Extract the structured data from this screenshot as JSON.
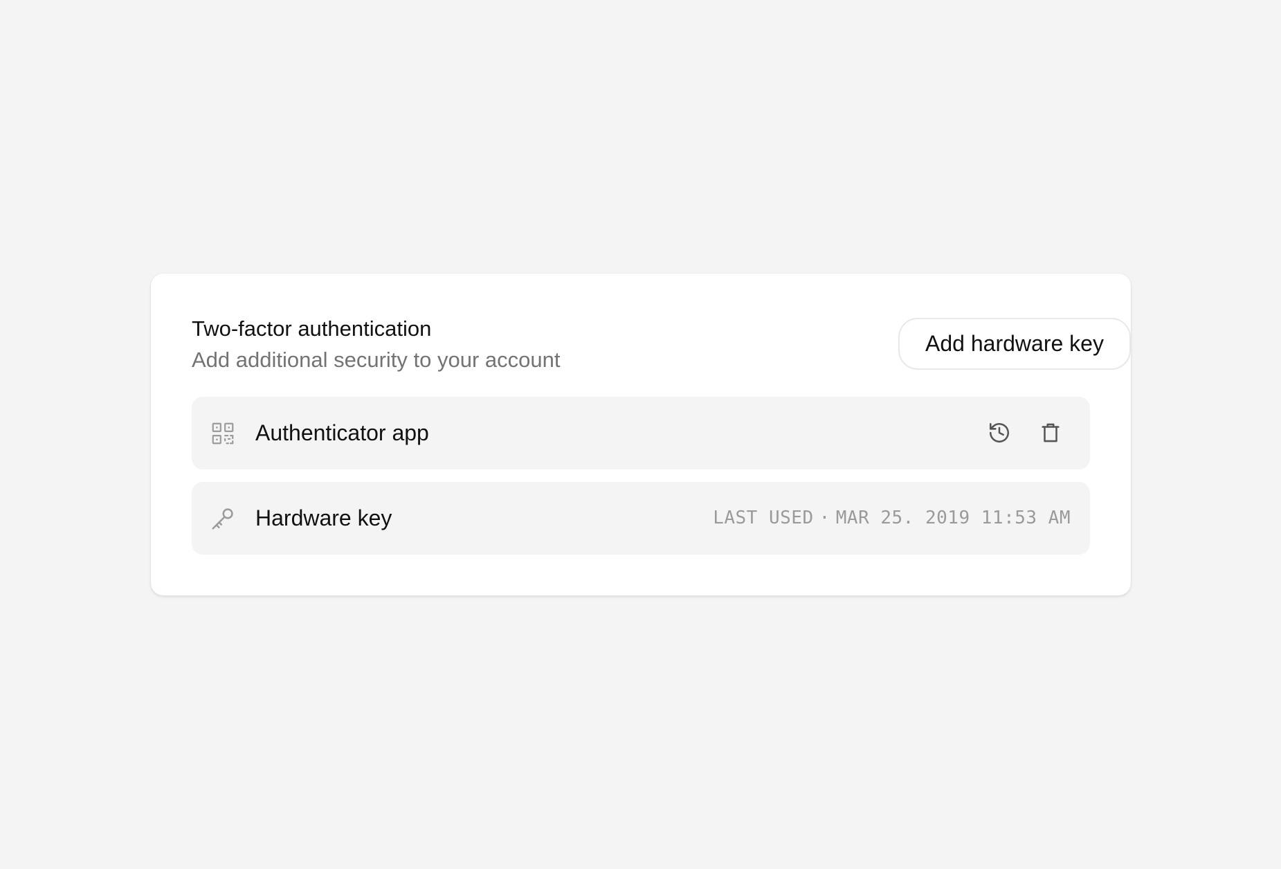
{
  "card": {
    "title": "Two-factor authentication",
    "subtitle": "Add additional security to your account",
    "add_button_label": "Add hardware key"
  },
  "methods": [
    {
      "label": "Authenticator app",
      "icon": "qr-code-icon",
      "actions": [
        {
          "icon": "history-icon"
        },
        {
          "icon": "trash-icon"
        }
      ]
    },
    {
      "label": "Hardware key",
      "icon": "key-icon",
      "last_used_label": "LAST USED",
      "separator": "·",
      "last_used_value": "MAR 25. 2019 11:53 AM"
    }
  ],
  "colors": {
    "page_background": "#f4f4f4",
    "card_background": "#ffffff",
    "row_background": "#f4f4f4",
    "primary_text": "#111111",
    "secondary_text": "#737373",
    "muted_text": "#9a9a9a",
    "icon_gray": "#9b9b9b",
    "icon_dark": "#555555"
  }
}
